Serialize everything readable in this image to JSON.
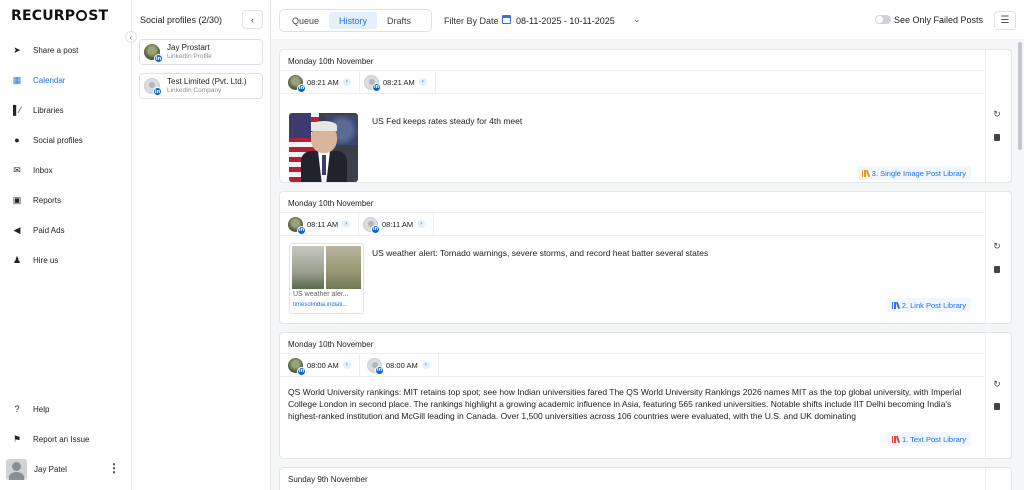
{
  "app": {
    "logo_text": "RECURPOST"
  },
  "nav": {
    "items": [
      {
        "label": "Share a post",
        "icon": "send-icon"
      },
      {
        "label": "Calendar",
        "icon": "calendar-icon",
        "active": true
      },
      {
        "label": "Libraries",
        "icon": "library-icon"
      },
      {
        "label": "Social profiles",
        "icon": "user-circle-icon"
      },
      {
        "label": "Inbox",
        "icon": "inbox-icon"
      },
      {
        "label": "Reports",
        "icon": "report-icon"
      },
      {
        "label": "Paid Ads",
        "icon": "megaphone-icon"
      },
      {
        "label": "Hire us",
        "icon": "person-icon"
      }
    ],
    "bottom_items": [
      {
        "label": "Help",
        "icon": "help-icon"
      },
      {
        "label": "Report an Issue",
        "icon": "flag-icon"
      }
    ],
    "user": {
      "name": "Jay Patel"
    }
  },
  "profiles": {
    "title": "Social profiles (2/30)",
    "items": [
      {
        "name": "Jay Prostart",
        "type": "LinkedIn Profile"
      },
      {
        "name": "Test Limited (Pvt. Ltd.)",
        "type": "LinkedIn Company"
      }
    ]
  },
  "header": {
    "tabs": [
      {
        "label": "Queue"
      },
      {
        "label": "History",
        "active": true
      },
      {
        "label": "Drafts"
      }
    ],
    "filter_label": "Filter By Date",
    "date_range": "08-11-2025 - 10-11-2025",
    "failed_toggle_label": "See Only Failed Posts",
    "failed_toggle_on": false
  },
  "posts": [
    {
      "date": "Monday 10th November",
      "times": [
        "08:21 AM",
        "08:21 AM"
      ],
      "text": "US Fed keeps rates steady for 4th meet",
      "library": "3. Single Image Post Library",
      "library_color": "#e39a1c"
    },
    {
      "date": "Monday 10th November",
      "times": [
        "08:11 AM",
        "08:11 AM"
      ],
      "text": "US weather alert: Tornado warnings, severe storms, and record heat batter several states",
      "link_title": "US weather aler...",
      "link_url": "timesofindia.indiati...",
      "library": "2. Link Post Library",
      "library_color": "#3b6fd8"
    },
    {
      "date": "Monday 10th November",
      "times": [
        "08:00 AM",
        "08:00 AM"
      ],
      "text": "QS World University rankings: MIT retains top spot; see how Indian universities fared The QS World University Rankings 2026 names MIT as the top global university, with Imperial College London in second place. The rankings highlight a growing academic influence in Asia, featuring 565 ranked universities. Notable shifts include IIT Delhi becoming India's highest-ranked institution and McGill leading in Canada. Over 1,500 universities across 106 countries were evaluated, with the U.S. and UK dominating",
      "library": "1. Text Post Library",
      "library_color": "#e0453a"
    },
    {
      "date": "Sunday 9th November"
    }
  ]
}
